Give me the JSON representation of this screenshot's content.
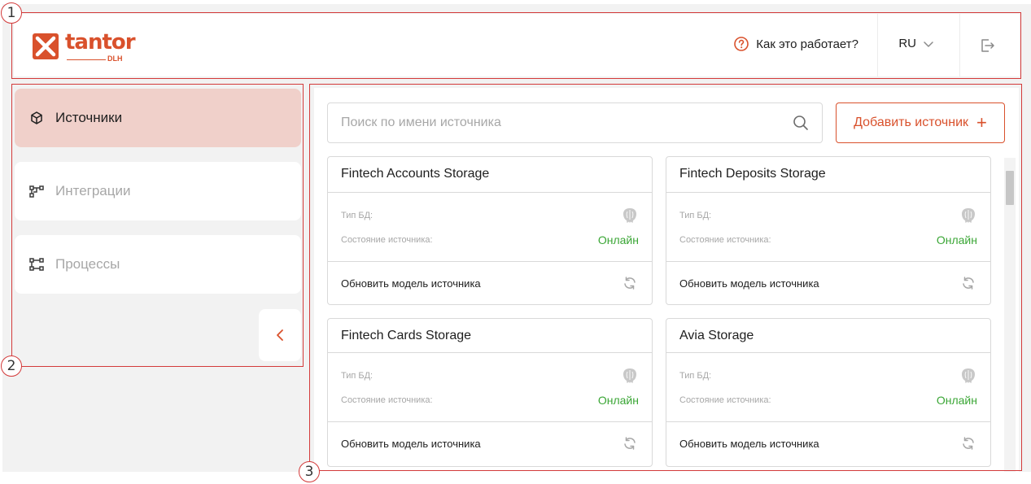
{
  "annotations": [
    "1",
    "2",
    "3"
  ],
  "header": {
    "logo_text": "tantor",
    "logo_sub": "DLH",
    "help_text": "Как это работает?",
    "language": "RU"
  },
  "sidebar": {
    "items": [
      {
        "label": "Источники",
        "icon": "cube-icon",
        "active": true
      },
      {
        "label": "Интеграции",
        "icon": "integration-icon",
        "active": false
      },
      {
        "label": "Процессы",
        "icon": "process-icon",
        "active": false
      }
    ]
  },
  "main": {
    "search_placeholder": "Поиск по имени источника",
    "add_button_label": "Добавить источник",
    "cards": [
      {
        "title": "Fintech Accounts Storage",
        "db_type_label": "Тип БД:",
        "status_label": "Состояние источника:",
        "status": "Онлайн",
        "refresh_label": "Обновить модель источника"
      },
      {
        "title": "Fintech Deposits Storage",
        "db_type_label": "Тип БД:",
        "status_label": "Состояние источника:",
        "status": "Онлайн",
        "refresh_label": "Обновить модель источника"
      },
      {
        "title": "Fintech Cards Storage",
        "db_type_label": "Тип БД:",
        "status_label": "Состояние источника:",
        "status": "Онлайн",
        "refresh_label": "Обновить модель источника"
      },
      {
        "title": "Avia Storage",
        "db_type_label": "Тип БД:",
        "status_label": "Состояние источника:",
        "status": "Онлайн",
        "refresh_label": "Обновить модель источника"
      }
    ]
  },
  "colors": {
    "accent": "#d9512c",
    "active_nav_bg": "#f0d0ca",
    "online": "#3aa635",
    "annotation": "#d33a3a"
  }
}
